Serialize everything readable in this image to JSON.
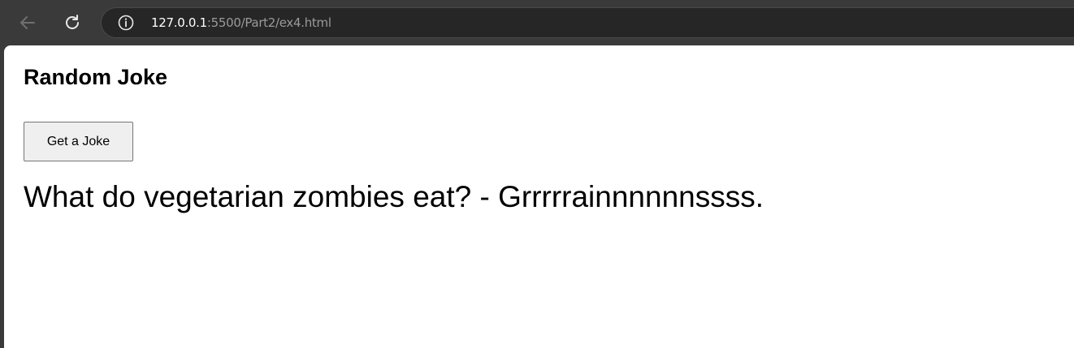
{
  "browser": {
    "url_host": "127.0.0.1",
    "url_path": ":5500/Part2/ex4.html",
    "icons": {
      "back": "back-arrow-icon",
      "reload": "reload-icon",
      "info": "info-icon"
    },
    "colors": {
      "chrome_bg": "#3a3a3a",
      "address_bg": "#262626",
      "url_host": "#ffffff",
      "url_path": "#9a9a9a"
    }
  },
  "page": {
    "title": "Random Joke",
    "button_label": "Get a Joke",
    "joke": "What do vegetarian zombies eat? - Grrrrrainnnnnnssss."
  }
}
